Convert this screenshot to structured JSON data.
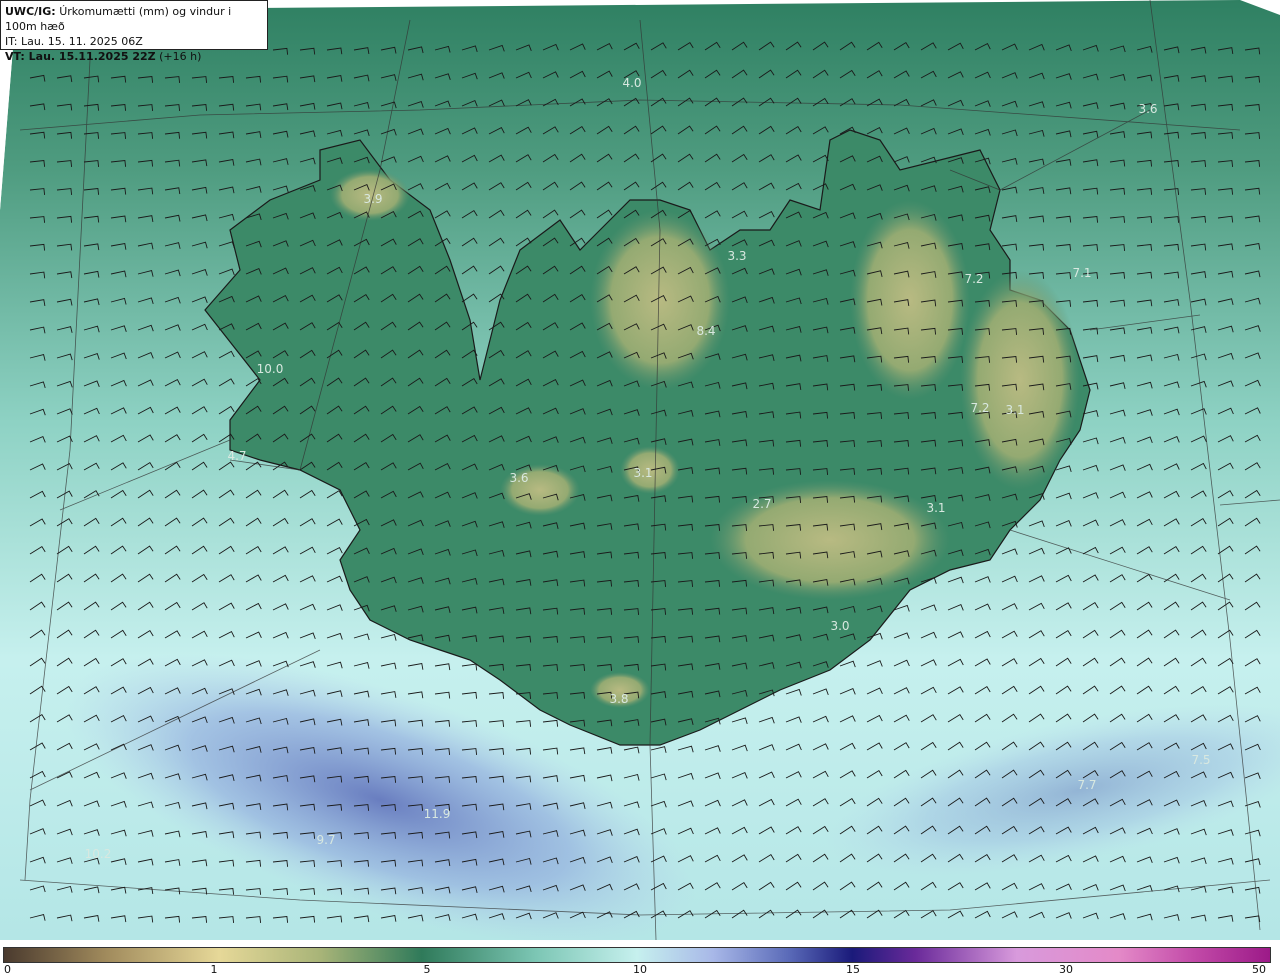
{
  "header": {
    "model_label": "UWC/IG:",
    "product": "Úrkomumætti (mm) og vindur i 100m hæð",
    "initial_time": "IT: Lau. 15. 11. 2025 06Z",
    "valid_time": "VT: Lau. 15.11.2025 22Z",
    "lead": "(+16 h)"
  },
  "colors": {
    "sea_light": "#c6f0ee",
    "sea_mid": "#8ed2c4",
    "land_green": "#2f7a5a",
    "highland": "#a8b478",
    "rain_blue": "#8aa0dc",
    "coast_line": "#1a1a1a"
  },
  "colorbar": {
    "ticks": [
      "0",
      "1",
      "5",
      "10",
      "15",
      "30",
      "50"
    ]
  },
  "map_values": [
    "4.0",
    "3.6",
    "3.9",
    "3.3",
    "7.2",
    "7.1",
    "8.4",
    "10.0",
    "7.2",
    "3.1",
    "4.7",
    "3.6",
    "3.1",
    "2.7",
    "3.1",
    "3.0",
    "3.8",
    "7.5",
    "7.7",
    "11.9",
    "9.7",
    "10.2"
  ]
}
